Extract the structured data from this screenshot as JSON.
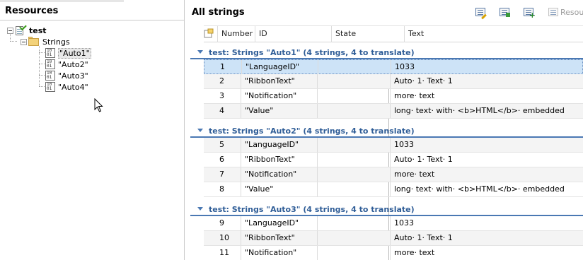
{
  "left_panel": {
    "title": "Resources",
    "tree": {
      "root": "test",
      "folder": "Strings",
      "items": [
        "\"Auto1\"",
        "\"Auto2\"",
        "\"Auto3\"",
        "\"Auto4\""
      ],
      "selected_index": 0
    }
  },
  "right_panel": {
    "title": "All strings",
    "toolbar": {
      "buttons": [
        "edit-icon",
        "import-icon",
        "add-icon",
        "resources-icon"
      ],
      "resources_label": "Resour"
    },
    "columns": {
      "number": "Number",
      "id": "ID",
      "state": "State",
      "text": "Text"
    },
    "groups": [
      {
        "title": "test: Strings \"Auto1\"  (4 strings, 4 to translate)",
        "rows": [
          {
            "number": "1",
            "id": "\"LanguageID\"",
            "state": "",
            "text": "1033"
          },
          {
            "number": "2",
            "id": "\"RibbonText\"",
            "state": "",
            "text": "Auto· 1· Text· 1"
          },
          {
            "number": "3",
            "id": "\"Notification\"",
            "state": "",
            "text": "more· text"
          },
          {
            "number": "4",
            "id": "\"Value\"",
            "state": "",
            "text": "long· text· with· <b>HTML</b>· embedded"
          }
        ]
      },
      {
        "title": "test: Strings \"Auto2\"  (4 strings, 4 to translate)",
        "rows": [
          {
            "number": "5",
            "id": "\"LanguageID\"",
            "state": "",
            "text": "1033"
          },
          {
            "number": "6",
            "id": "\"RibbonText\"",
            "state": "",
            "text": "Auto· 1· Text· 1"
          },
          {
            "number": "7",
            "id": "\"Notification\"",
            "state": "",
            "text": "more· text"
          },
          {
            "number": "8",
            "id": "\"Value\"",
            "state": "",
            "text": "long· text· with· <b>HTML</b>· embedded"
          }
        ]
      },
      {
        "title": "test: Strings \"Auto3\"  (4 strings, 4 to translate)",
        "rows": [
          {
            "number": "9",
            "id": "\"LanguageID\"",
            "state": "",
            "text": "1033"
          },
          {
            "number": "10",
            "id": "\"RibbonText\"",
            "state": "",
            "text": "Auto· 1· Text· 1"
          },
          {
            "number": "11",
            "id": "\"Notification\"",
            "state": "",
            "text": "more· text"
          }
        ]
      }
    ],
    "selected_row": "1"
  },
  "colors": {
    "group_text": "#2f5d97",
    "group_line": "#4a78b3",
    "selection": "#cde3f7"
  }
}
